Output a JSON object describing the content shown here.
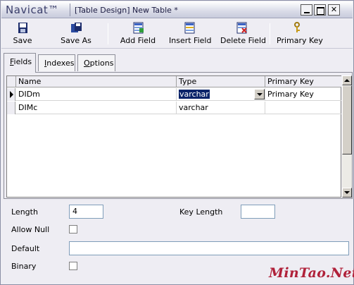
{
  "titlebar": {
    "app_name": "Navicat™",
    "window_title": "[Table Design] New Table *"
  },
  "toolbar": {
    "buttons": [
      {
        "label": "Save",
        "icon": "floppy-disk-icon"
      },
      {
        "label": "Save As",
        "icon": "save-as-icon"
      },
      {
        "label": "Add Field",
        "icon": "add-field-icon"
      },
      {
        "label": "Insert Field",
        "icon": "insert-field-icon"
      },
      {
        "label": "Delete Field",
        "icon": "delete-field-icon"
      },
      {
        "label": "Primary Key",
        "icon": "key-icon"
      }
    ]
  },
  "tabs": [
    {
      "label_acc": "F",
      "label_rest": "ields",
      "active": true
    },
    {
      "label_acc": "I",
      "label_rest": "ndexes",
      "active": false
    },
    {
      "label_acc": "O",
      "label_rest": "ptions",
      "active": false
    }
  ],
  "grid": {
    "columns": [
      "Name",
      "Type",
      "Primary Key"
    ],
    "rows": [
      {
        "name": "DIDm",
        "type": "varchar",
        "primary_key": "Primary Key",
        "current": true
      },
      {
        "name": "DIMc",
        "type": "varchar",
        "primary_key": "",
        "current": false
      }
    ]
  },
  "properties": {
    "length_label": "Length",
    "length_value": "4",
    "key_length_label": "Key Length",
    "key_length_value": "",
    "allow_null_label": "Allow Null",
    "default_label": "Default",
    "default_value": "",
    "binary_label": "Binary"
  },
  "watermark": "MinTao.Net",
  "colors": {
    "selection": "#0a246a",
    "watermark": "#b0213a"
  }
}
